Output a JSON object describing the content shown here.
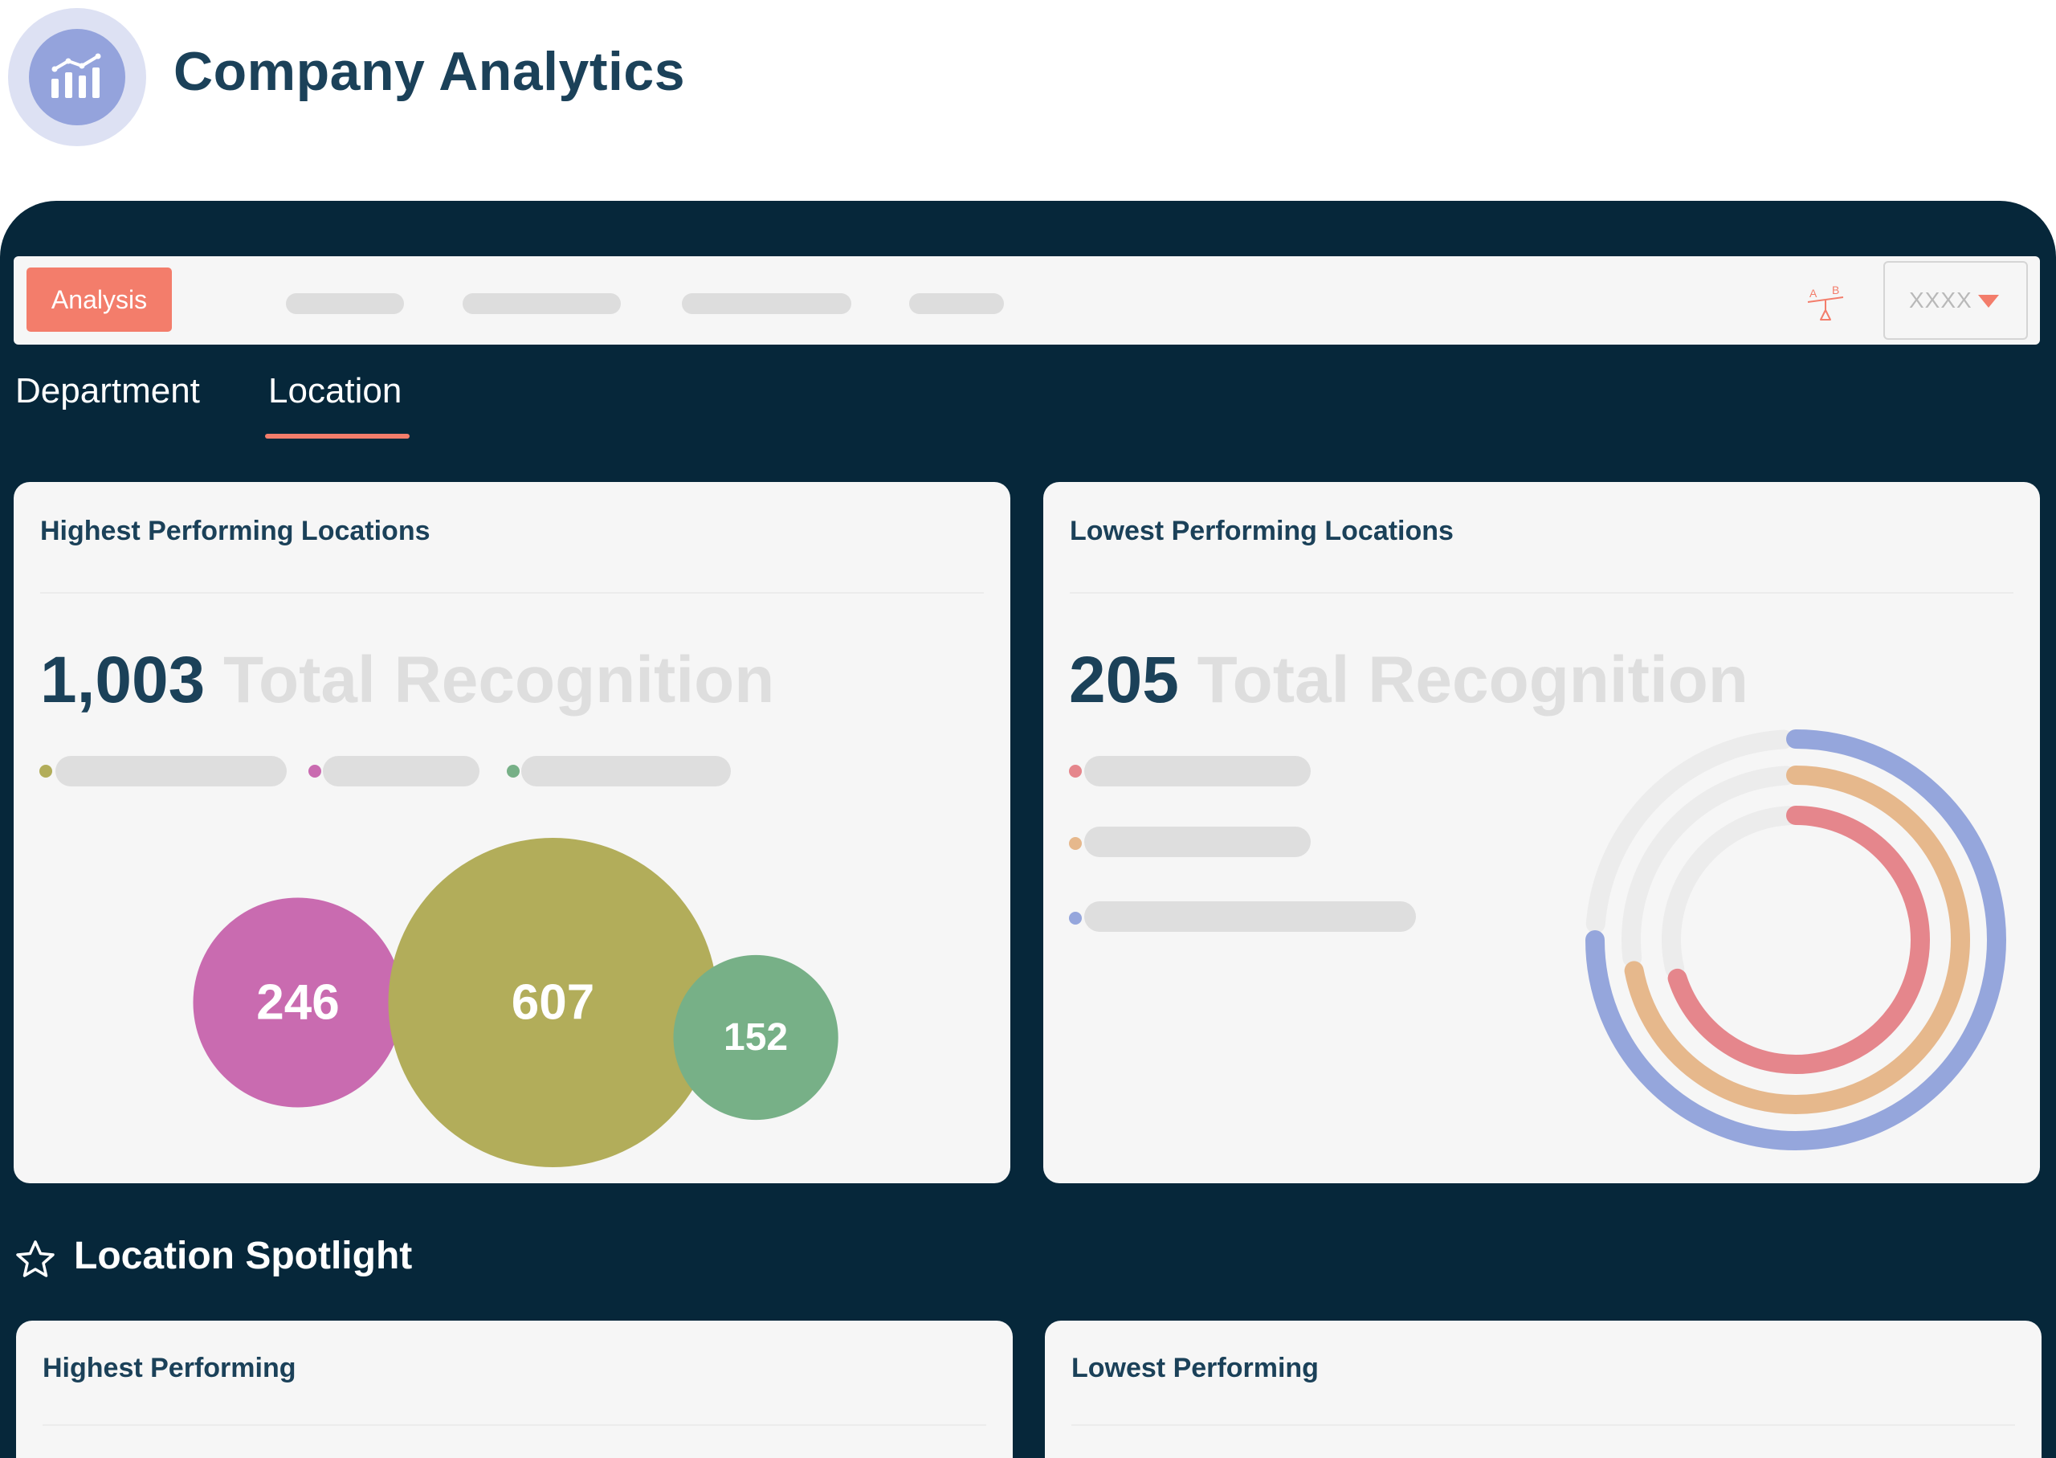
{
  "app": {
    "title": "Company Analytics",
    "logo_icon": "bar-chart-icon"
  },
  "toolbar": {
    "analysis_label": "Analysis",
    "compare_icon": "ab-test-icon",
    "select_value": "XXXX",
    "select_icon": "caret-down-icon"
  },
  "tabs": [
    {
      "label": "Department",
      "active": false
    },
    {
      "label": "Location",
      "active": true
    }
  ],
  "cards": {
    "highest": {
      "title": "Highest Performing Locations",
      "total": "1,003",
      "total_label": "Total Recognition"
    },
    "lowest": {
      "title": "Lowest Performing Locations",
      "total": "205",
      "total_label": "Total Recognition"
    }
  },
  "chart_data": [
    {
      "type": "bubble",
      "title": "Highest Performing Locations",
      "values": [
        246,
        607,
        152
      ],
      "colors": [
        "#c96bb0",
        "#b2ad5a",
        "#77b087"
      ],
      "legend_colors": [
        "#b2ad5a",
        "#c96bb0",
        "#77b087"
      ]
    },
    {
      "type": "radial-bar",
      "title": "Lowest Performing Locations",
      "series_colors": [
        "#e5868c",
        "#e6b88c",
        "#95a6dc"
      ],
      "fractions": [
        0.7,
        0.72,
        0.75
      ],
      "track_color": "#ececec"
    }
  ],
  "spotlight": {
    "title": "Location Spotlight",
    "icon": "star-icon",
    "highest_title": "Highest Performing",
    "lowest_title": "Lowest Performing"
  }
}
